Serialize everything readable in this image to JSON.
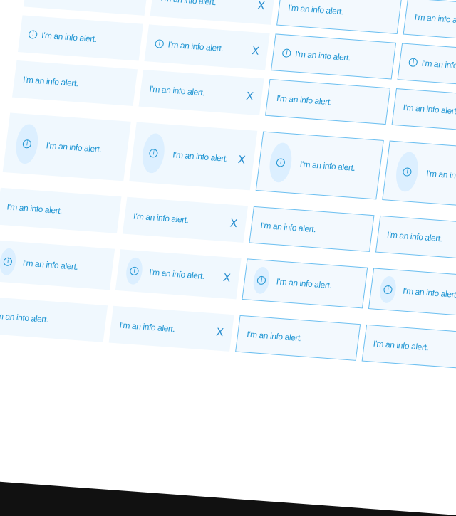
{
  "alert_text": "I'm an info alert.",
  "close_label": "X",
  "icon_glyph": "i",
  "colors": {
    "accent": "#2196d3",
    "alert_bg": "#f0f8fe",
    "border": "#6cbff0",
    "icon_bg": "#dcefff"
  },
  "rows": [
    {
      "size": "small",
      "icon": "none"
    },
    {
      "size": "small",
      "icon": "info-circle"
    },
    {
      "size": "small",
      "icon": "none"
    },
    {
      "size": "large",
      "icon": "info-circle-blob"
    },
    {
      "size": "small",
      "icon": "none"
    },
    {
      "size": "medium",
      "icon": "info-circle-blob"
    },
    {
      "size": "small",
      "icon": "none"
    }
  ],
  "columns": [
    {
      "variant": "filled",
      "closable": false
    },
    {
      "variant": "filled",
      "closable": true
    },
    {
      "variant": "outlined",
      "closable": false
    },
    {
      "variant": "outlined",
      "closable": false
    }
  ]
}
